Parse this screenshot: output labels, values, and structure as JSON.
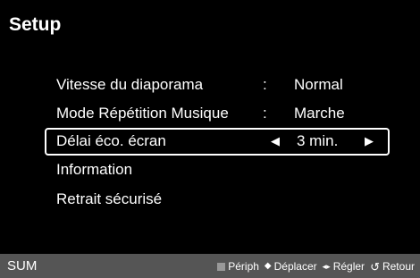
{
  "header": {
    "title": "Setup"
  },
  "menu": {
    "items": [
      {
        "label": "Vitesse du diaporama",
        "separator": ":",
        "value": "Normal"
      },
      {
        "label": "Mode Répétition Musique",
        "separator": ":",
        "value": "Marche"
      },
      {
        "label": "Délai éco. écran",
        "value": "3 min.",
        "left_arrow": "◀",
        "right_arrow": "▶"
      },
      {
        "label": "Information"
      },
      {
        "label": "Retrait sécurisé"
      }
    ]
  },
  "footer": {
    "source": "SUM",
    "hints": {
      "periph": "Périph",
      "move_icon": "◆",
      "move": "Déplacer",
      "adjust_icon": "◂▸",
      "adjust": "Régler",
      "return_icon": "↺",
      "return": "Retour"
    }
  },
  "colors": {
    "background": "#000000",
    "text": "#ffffff",
    "footer": "#555555",
    "periph_square": "#999999"
  }
}
